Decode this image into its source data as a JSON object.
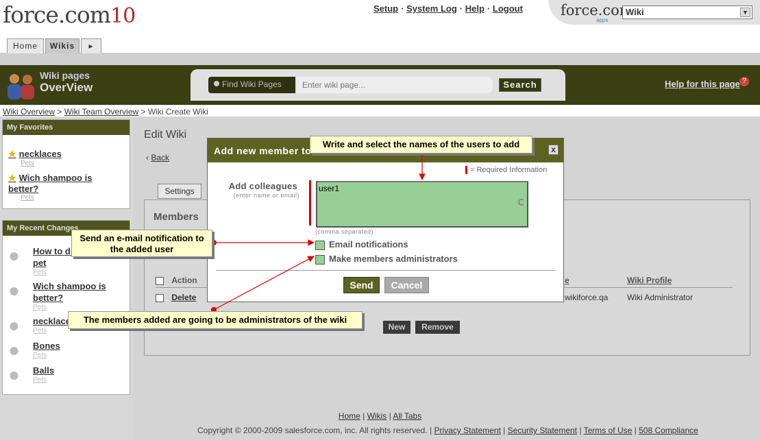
{
  "header": {
    "logo_text": "force.com",
    "logo_suffix": "10",
    "top_links": [
      "Setup",
      "System Log",
      "Help",
      "Logout"
    ],
    "app_logo": "force.com",
    "app_logo_sub": "apps",
    "app_selector_value": "Wiki"
  },
  "tabs": [
    {
      "label": "Home"
    },
    {
      "label": "Wikis"
    },
    {
      "label": "▸"
    }
  ],
  "band": {
    "title_line1": "Wiki pages",
    "title_line2": "OverView",
    "find_label": "Find Wiki Pages",
    "search_placeholder": "Enter wiki page...",
    "search_button": "Search",
    "help_link": "Help for this page",
    "help_icon": "question-icon"
  },
  "breadcrumb": {
    "items": [
      "Wiki Overview",
      "Wiki Team Overview",
      "Wiki Create Wiki"
    ],
    "separator": ">"
  },
  "sidebar": {
    "favorites_title": "My Favorites",
    "favorites": [
      {
        "label": "necklaces",
        "sub": "Pets"
      },
      {
        "label": "Wich shampoo is better?",
        "sub": "Pets"
      }
    ],
    "recent_title": "My Recent Changes",
    "recent": [
      {
        "label": "How to dress your pet",
        "sub": "Pets"
      },
      {
        "label": "Wich shampoo is better?",
        "sub": "Pets"
      },
      {
        "label": "necklaces",
        "sub": "Pets"
      },
      {
        "label": "Bones",
        "sub": "Pets"
      },
      {
        "label": "Balls",
        "sub": "Pets"
      }
    ]
  },
  "main": {
    "title": "Edit Wiki",
    "back_link": "Back",
    "settings_tab": "Settings",
    "members_title": "Members",
    "table_headers": [
      "Action",
      "e",
      "Wiki Profile"
    ],
    "table_rows": [
      {
        "action": "Delete",
        "email": "wikiforce.qa",
        "profile": "Wiki Administrator"
      }
    ],
    "new_button": "New",
    "remove_button": "Remove"
  },
  "modal": {
    "title": "Add new member to",
    "close_label": "x",
    "required_info": "= Required Information",
    "add_label": "Add colleagues",
    "add_sub": "(enter name or email)",
    "colleagues_value": "user1",
    "comma_hint": "(comma separated)",
    "email_notifications": "Email notifications",
    "make_admins": "Make members administrators",
    "send_button": "Send",
    "cancel_button": "Cancel"
  },
  "callouts": {
    "top": "Write and select the names of the users to add",
    "left": "Send an e-mail notification to the added user",
    "bottom": "The members added are going to be administrators of the wiki"
  },
  "footer": {
    "links": [
      "Home",
      "Wikis",
      "All Tabs"
    ],
    "copyright": "Copyright © 2000-2009 salesforce.com, inc. All rights reserved.",
    "legal_links": [
      "Privacy Statement",
      "Security Statement",
      "Terms of Use",
      "508 Compliance"
    ]
  },
  "colors": {
    "band": "#3b3f14",
    "modal_header": "#5c6320",
    "field_green": "#98cf97",
    "callout_bg": "#ffffcc",
    "arrow_red": "#e00000"
  }
}
